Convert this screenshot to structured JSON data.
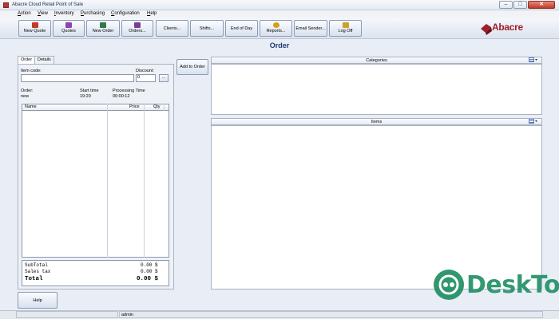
{
  "window": {
    "title": "Abacre Cloud Retail Point of Sale",
    "minimize": "–",
    "maximize": "□",
    "close": "✕"
  },
  "menu": [
    {
      "label": "Action",
      "u": "A",
      "rest": "ction"
    },
    {
      "label": "View",
      "u": "V",
      "rest": "iew"
    },
    {
      "label": "Inventory",
      "u": "I",
      "rest": "nventory"
    },
    {
      "label": "Purchasing",
      "u": "P",
      "rest": "urchasing"
    },
    {
      "label": "Configuration",
      "u": "C",
      "rest": "onfiguration"
    },
    {
      "label": "Help",
      "u": "H",
      "rest": "elp"
    }
  ],
  "toolbar": {
    "buttons": [
      {
        "label": "New Quote",
        "icon": "new-quote-icon",
        "color": "#c0392b"
      },
      {
        "label": "Quotes",
        "icon": "quotes-icon",
        "color": "#8e44ad"
      },
      {
        "label": "New Order",
        "icon": "new-order-icon",
        "color": "#2c7d45"
      },
      {
        "label": "Orders...",
        "icon": "orders-icon",
        "color": "#7d3c98"
      },
      {
        "label": "Clients...",
        "icon": "",
        "color": ""
      },
      {
        "label": "Shifts...",
        "icon": "",
        "color": ""
      },
      {
        "label": "End of Day",
        "icon": "",
        "color": ""
      },
      {
        "label": "Reports...",
        "icon": "reports-icon",
        "color": "#d4a017"
      },
      {
        "label": "Email Sender...",
        "icon": "",
        "color": ""
      },
      {
        "label": "Log Off",
        "icon": "log-off-icon",
        "color": "#c9a227"
      }
    ],
    "logo": "Abacre",
    "logo_color": "#9c1f2b"
  },
  "page_title": "Order",
  "left": {
    "tabs": [
      "Order",
      "Details"
    ],
    "item_code_label": "Item code:",
    "item_code_value": "",
    "discount_label": "Discount:",
    "discount_value": "0",
    "browse_label": "...",
    "order_label": "Order:",
    "order_value": "new",
    "start_time_label": "Start time",
    "start_time_value": "19:20",
    "processing_time_label": "Processing Time",
    "processing_time_value": "00:00:12",
    "columns": [
      "Name",
      "Price",
      "Qty"
    ],
    "rows": [],
    "totals": [
      {
        "label": "SubTotal",
        "value": "0.00 $"
      },
      {
        "label": "Sales tax",
        "value": "0.00 $"
      },
      {
        "label": "Total",
        "value": "0.00 $"
      }
    ]
  },
  "add_to_order": "Add to Order",
  "categories": {
    "header": "Categories",
    "menu_icon": "grid-view-icon"
  },
  "items": {
    "header": "Items",
    "menu_icon": "grid-view-icon"
  },
  "help_button": "Help",
  "status": {
    "user": "admin"
  },
  "watermark": "DeskTop"
}
